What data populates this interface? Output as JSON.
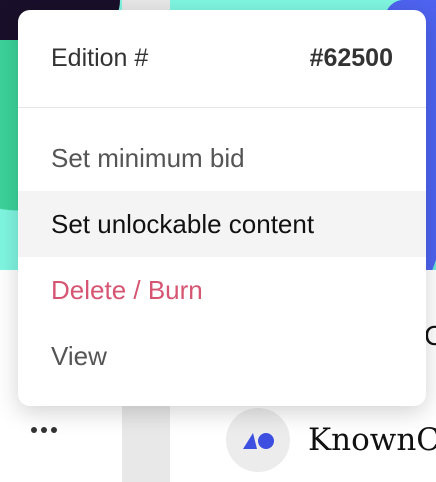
{
  "menu": {
    "edition_label": "Edition #",
    "edition_value": "#62500",
    "items": [
      {
        "label": "Set minimum bid",
        "state": "default"
      },
      {
        "label": "Set unlockable content",
        "state": "hover"
      },
      {
        "label": "Delete / Burn",
        "state": "danger"
      },
      {
        "label": "View",
        "state": "default"
      }
    ]
  },
  "creator": {
    "name": "KnownC"
  },
  "side_text": "C",
  "colors": {
    "danger": "#d65573",
    "hover_bg": "#f4f4f4",
    "accent_blue": "#4e63f0",
    "accent_mint": "#7ff6e1"
  },
  "icons": {
    "more": "ellipsis-icon",
    "avatar": "creator-logo-icon"
  }
}
